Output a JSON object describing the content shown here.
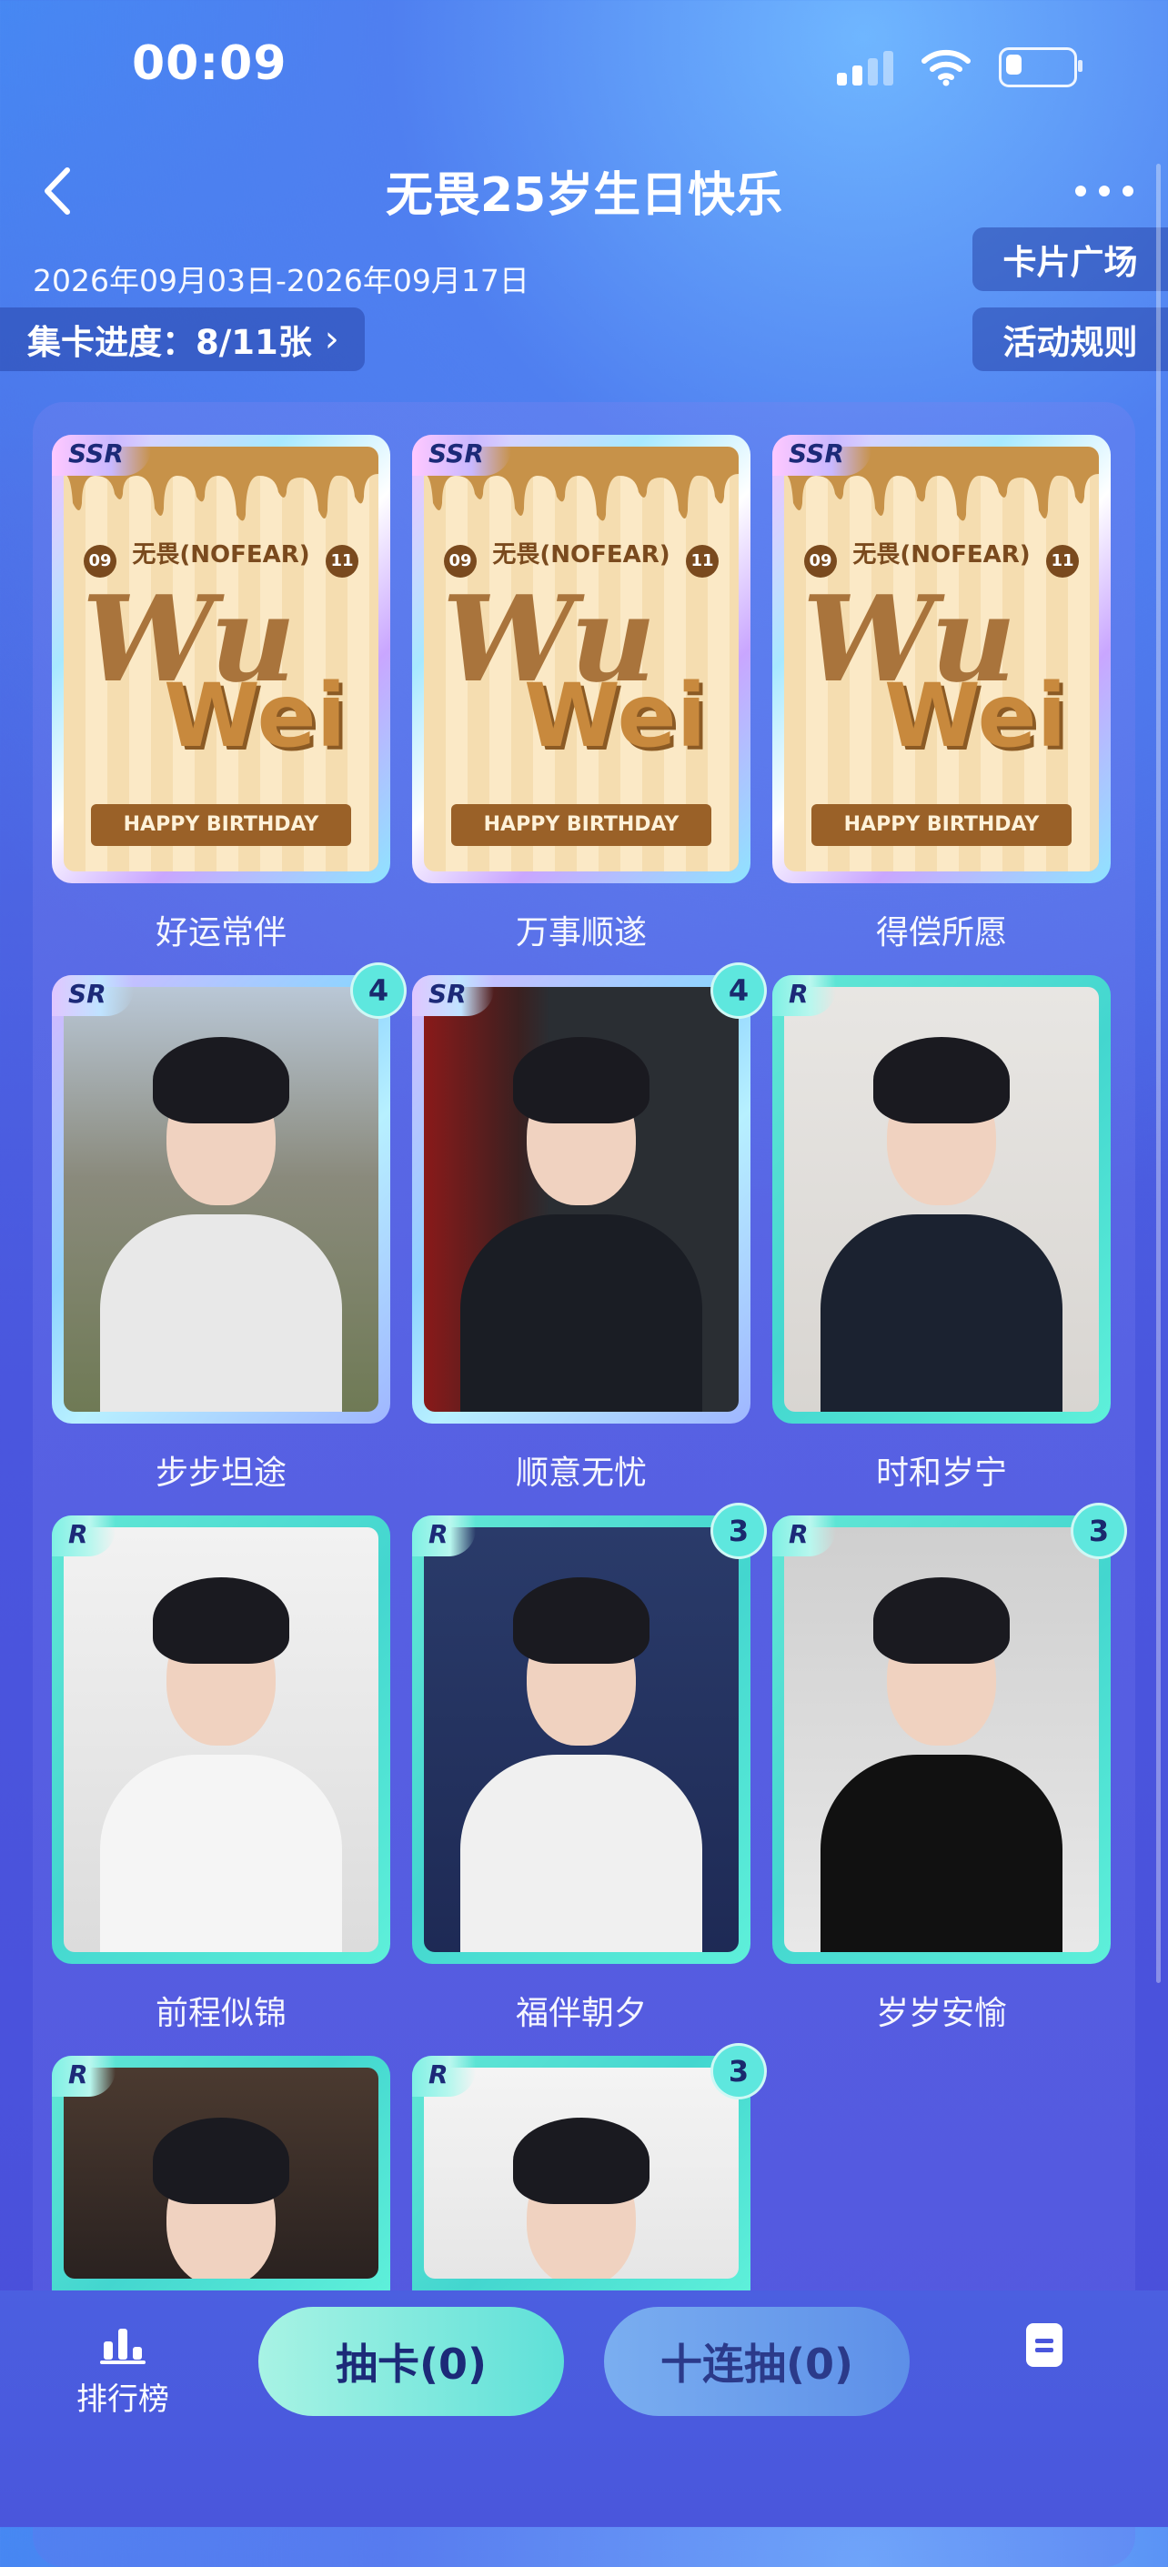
{
  "status_bar": {
    "time": "00:09",
    "battery_level": 0.25
  },
  "header": {
    "title": "无畏25岁生日快乐"
  },
  "event": {
    "date_range": "2026年09月03日-2026年09月17日"
  },
  "progress": {
    "label": "集卡进度：8/11张",
    "chevron": "›"
  },
  "side_buttons": {
    "card_plaza": "卡片广场",
    "activity_rules": "活动规则"
  },
  "ssr_art": {
    "brand": "无畏(NOFEAR)",
    "wu": "Wu",
    "wei": "Wei",
    "ribbon": "HAPPY BIRTHDAY",
    "num_left": "09",
    "num_right": "11"
  },
  "cards": [
    {
      "rarity": "SSR",
      "label": "好运常伴",
      "count": ""
    },
    {
      "rarity": "SSR",
      "label": "万事顺遂",
      "count": ""
    },
    {
      "rarity": "SSR",
      "label": "得偿所愿",
      "count": ""
    },
    {
      "rarity": "SR",
      "label": "步步坦途",
      "count": "4"
    },
    {
      "rarity": "SR",
      "label": "顺意无忧",
      "count": "4"
    },
    {
      "rarity": "R",
      "label": "时和岁宁",
      "count": ""
    },
    {
      "rarity": "R",
      "label": "前程似锦",
      "count": ""
    },
    {
      "rarity": "R",
      "label": "福伴朝夕",
      "count": "3"
    },
    {
      "rarity": "R",
      "label": "岁岁安愉",
      "count": "3"
    },
    {
      "rarity": "R",
      "label": "",
      "count": ""
    },
    {
      "rarity": "R",
      "label": "",
      "count": "3"
    }
  ],
  "bottom": {
    "rank_label": "排行榜",
    "draw_label": "抽卡(0)",
    "draw10_label": "十连抽(0)"
  },
  "colors": {
    "accent_teal": "#5ee7de",
    "bg_blue": "#4a56dc"
  }
}
